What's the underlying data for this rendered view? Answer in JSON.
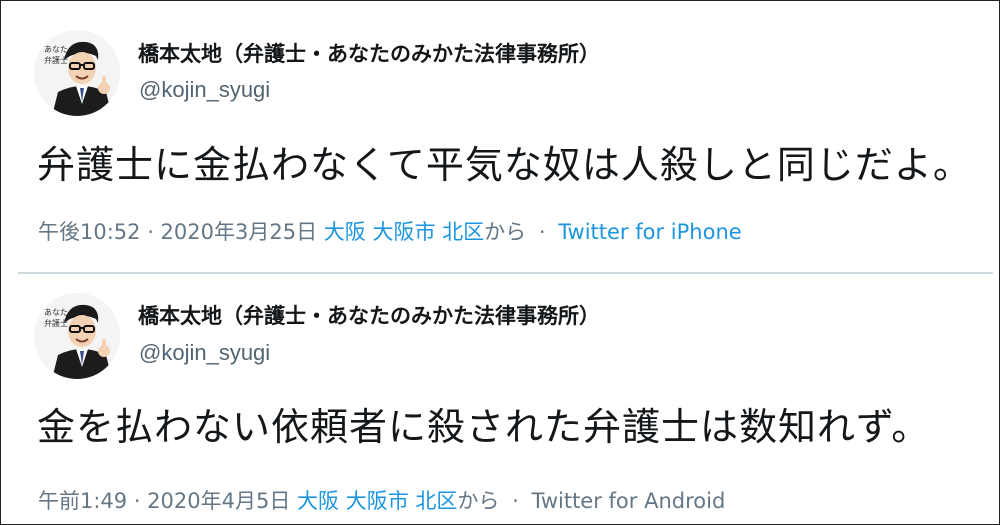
{
  "tweets": [
    {
      "author_name": "橋本太地（弁護士・あなたのみかた法律事務所）",
      "handle": "@kojin_syugi",
      "text": "弁護士に金払わなくて平気な奴は人殺しと同じだよ。",
      "timestamp": "午後10:52 · 2020年3月25日",
      "location": "大阪 大阪市 北区",
      "location_suffix": "から",
      "separator": "·",
      "source": "Twitter for iPhone",
      "source_color": "#1b95e0"
    },
    {
      "author_name": "橋本太地（弁護士・あなたのみかた法律事務所）",
      "handle": "@kojin_syugi",
      "text": "金を払わない依頼者に殺された弁護士は数知れず。",
      "timestamp": "午前1:49 · 2020年4月5日",
      "location": "大阪 大阪市 北区",
      "location_suffix": "から",
      "separator": "·",
      "source": "Twitter for Android",
      "source_color": "#657786"
    }
  ],
  "colors": {
    "link": "#1b95e0",
    "meta": "#657786",
    "text": "#14171a",
    "divider": "#cfd9de"
  }
}
